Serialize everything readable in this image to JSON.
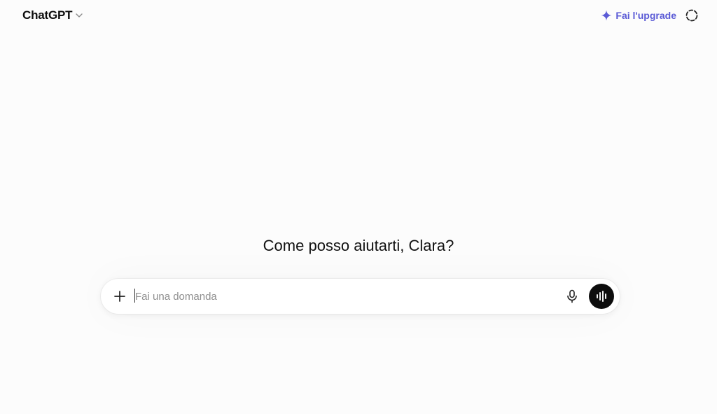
{
  "header": {
    "model_name": "ChatGPT",
    "upgrade_label": "Fai l'upgrade",
    "accent_color": "#5b5bd6"
  },
  "main": {
    "greeting": "Come posso aiutarti, Clara?"
  },
  "composer": {
    "placeholder": "Fai una domanda",
    "value": "",
    "icons": {
      "add": "plus-icon",
      "dictate": "microphone-icon",
      "voice": "voice-mode-icon"
    }
  },
  "icons": {
    "model_dropdown": "chevron-down-icon",
    "upgrade": "sparkle-icon",
    "temporary_chat": "temporary-chat-icon"
  }
}
